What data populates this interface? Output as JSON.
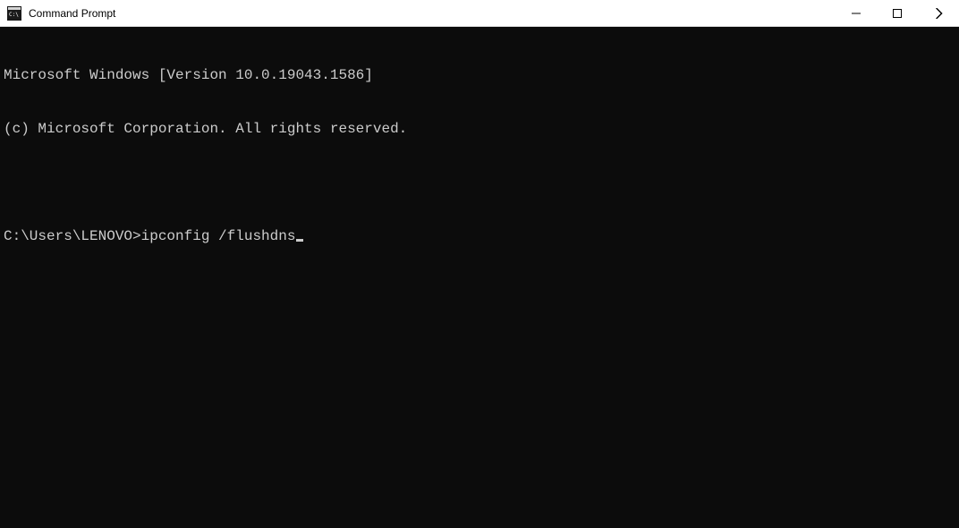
{
  "window": {
    "title": "Command Prompt"
  },
  "terminal": {
    "line1": "Microsoft Windows [Version 10.0.19043.1586]",
    "line2": "(c) Microsoft Corporation. All rights reserved.",
    "prompt": "C:\\Users\\LENOVO>",
    "command": "ipconfig /flushdns"
  }
}
